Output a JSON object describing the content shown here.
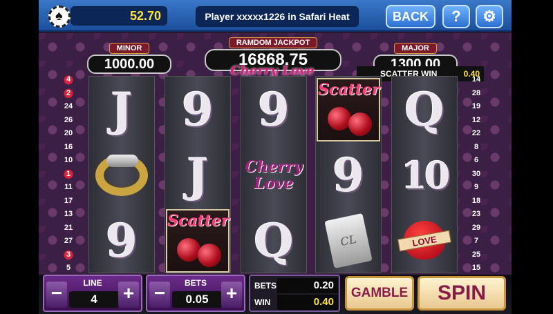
{
  "topbar": {
    "balance": "52.70",
    "message": "Player xxxxx1226 in Safari Heat",
    "back_label": "BACK",
    "help_label": "?",
    "settings_glyph": "⚙"
  },
  "jackpots": {
    "minor_label": "MINOR",
    "minor_value": "1000.00",
    "random_label": "RAMDOM JACKPOT",
    "random_value": "16868.75",
    "major_label": "MAJOR",
    "major_value": "1300.00"
  },
  "logo_text": "Cherry Love",
  "scatter_win": {
    "label": "SCATTER   WIN",
    "value": "0.40"
  },
  "lines_left": [
    "4",
    "2",
    "24",
    "26",
    "20",
    "16",
    "10",
    "1",
    "11",
    "17",
    "13",
    "21",
    "27",
    "3",
    "5"
  ],
  "lines_right": [
    "14",
    "28",
    "19",
    "12",
    "22",
    "8",
    "6",
    "30",
    "9",
    "18",
    "23",
    "29",
    "7",
    "25",
    "15"
  ],
  "heart_lines_left": [
    "4",
    "2",
    "1",
    "3"
  ],
  "reels": [
    [
      {
        "type": "letter",
        "text": "J"
      },
      {
        "type": "ring",
        "name": "gold-ring"
      },
      {
        "type": "letter",
        "text": "9"
      }
    ],
    [
      {
        "type": "letter",
        "text": "9"
      },
      {
        "type": "letter",
        "text": "J"
      },
      {
        "type": "scatter",
        "text": "Scatter"
      }
    ],
    [
      {
        "type": "letter",
        "text": "9"
      },
      {
        "type": "logo",
        "text": "Cherry Love"
      },
      {
        "type": "letter",
        "text": "Q"
      }
    ],
    [
      {
        "type": "scatter",
        "text": "Scatter"
      },
      {
        "type": "letter",
        "text": "9"
      },
      {
        "type": "lighter",
        "text": "CL"
      }
    ],
    [
      {
        "type": "letter",
        "text": "Q"
      },
      {
        "type": "letter",
        "text": "10"
      },
      {
        "type": "heart",
        "text": "LOVE"
      }
    ]
  ],
  "bottom": {
    "line_label": "LINE",
    "line_value": "4",
    "bets_label": "BETS",
    "bets_value": "0.05",
    "minus": "−",
    "plus": "+",
    "bets_total_label": "BETS",
    "bets_total_value": "0.20",
    "win_label": "WIN",
    "win_value": "0.40",
    "gamble_label": "GAMBLE",
    "spin_label": "SPIN"
  }
}
